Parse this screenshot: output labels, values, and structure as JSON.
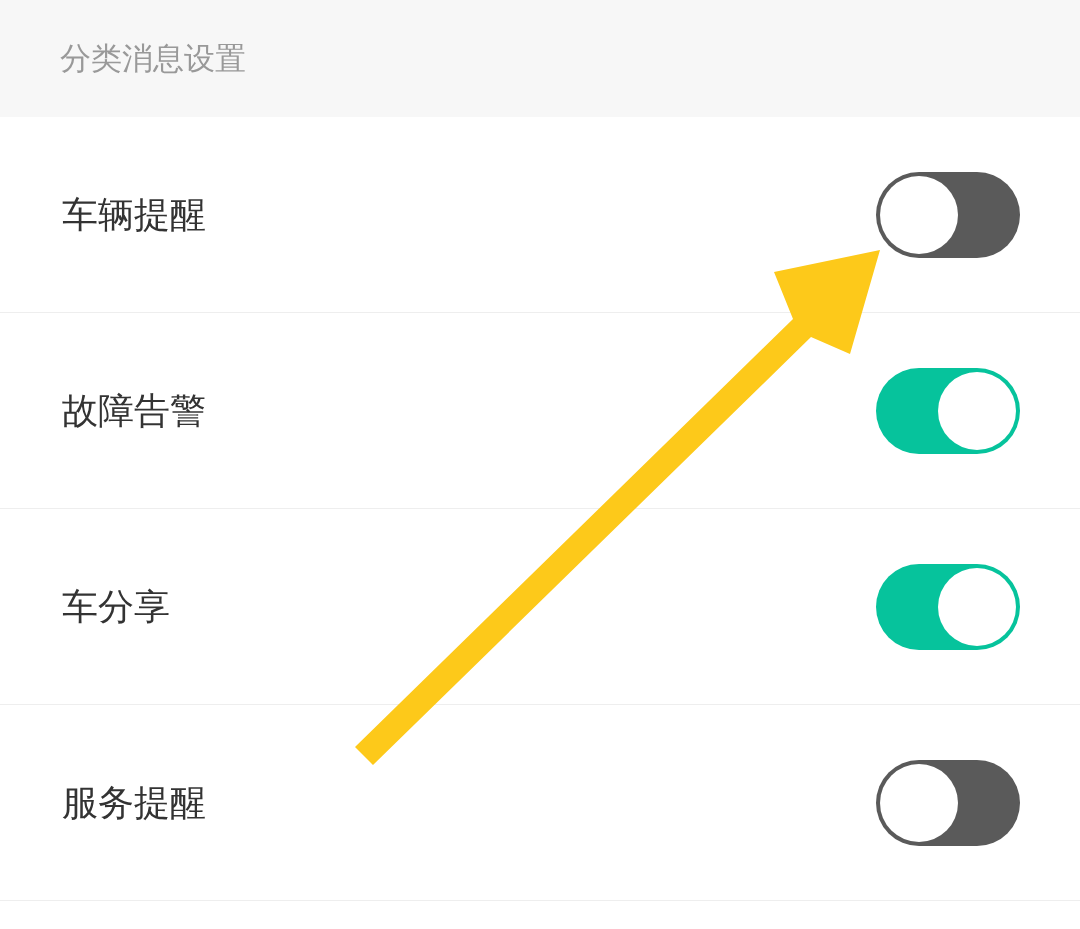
{
  "section_title": "分类消息设置",
  "items": [
    {
      "label": "车辆提醒",
      "on": false
    },
    {
      "label": "故障告警",
      "on": true
    },
    {
      "label": "车分享",
      "on": true
    },
    {
      "label": "服务提醒",
      "on": false
    }
  ]
}
